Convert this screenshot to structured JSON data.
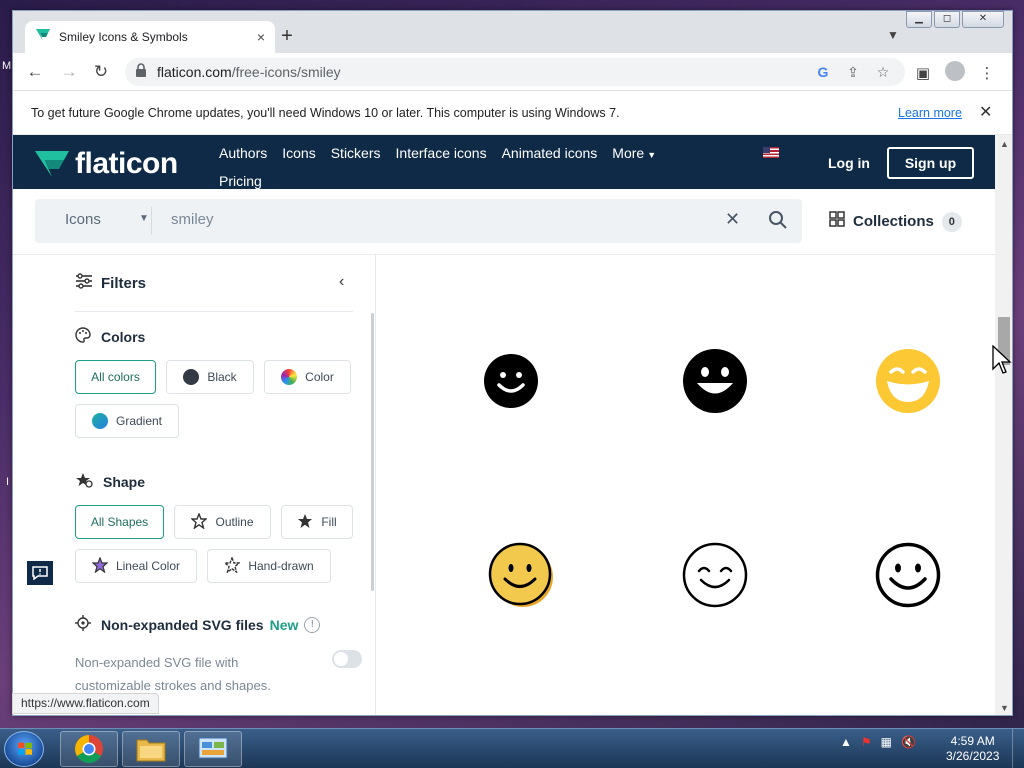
{
  "desktop": {
    "label_top": "M",
    "label_mid": "I"
  },
  "tab": {
    "title": "Smiley Icons & Symbols",
    "close": "×",
    "new_tab": "+"
  },
  "window_controls": {
    "minimize": "▭",
    "maximize": "◻",
    "close": "✕"
  },
  "address_bar": {
    "domain": "flaticon.com",
    "path": "/free-icons/smiley"
  },
  "infobar": {
    "message": "To get future Google Chrome updates, you'll need Windows 10 or later. This computer is using Windows 7.",
    "link": "Learn more",
    "close": "✕"
  },
  "flaticon": {
    "logo_text": "flaticon",
    "nav": [
      "Authors",
      "Icons",
      "Stickers",
      "Interface icons",
      "Animated icons",
      "More",
      "Pricing"
    ],
    "login": "Log in",
    "signup": "Sign up"
  },
  "search": {
    "type": "Icons",
    "query": "smiley",
    "collections_label": "Collections",
    "collections_count": "0"
  },
  "filters": {
    "title": "Filters",
    "colors_title": "Colors",
    "colors": [
      {
        "label": "All colors",
        "active": true
      },
      {
        "label": "Black",
        "swatch": "#333a45"
      },
      {
        "label": "Color",
        "swatch": "conic"
      },
      {
        "label": "Gradient",
        "swatch": "gradient"
      }
    ],
    "shape_title": "Shape",
    "shapes": [
      {
        "label": "All Shapes",
        "active": true
      },
      {
        "label": "Outline",
        "icon": "star-outline-icon"
      },
      {
        "label": "Fill",
        "icon": "star-fill-icon"
      },
      {
        "label": "Lineal Color",
        "icon": "star-lineal-icon"
      },
      {
        "label": "Hand-drawn",
        "icon": "star-handdrawn-icon"
      }
    ],
    "svg_title": "Non-expanded SVG files",
    "svg_new": "New",
    "svg_info": "!",
    "svg_desc": "Non-expanded SVG file with customizable strokes and shapes."
  },
  "results": [
    {
      "name": "smiley-black-simple"
    },
    {
      "name": "smiley-black-grin"
    },
    {
      "name": "smiley-yellow-laugh"
    },
    {
      "name": "smiley-yellow-outline"
    },
    {
      "name": "smiley-outline-closed-eyes"
    },
    {
      "name": "smiley-outline-bold"
    }
  ],
  "status_url": "https://www.flaticon.com",
  "clock": {
    "time": "4:59 AM",
    "date": "3/26/2023"
  },
  "colors": {
    "header_bg": "#0e2a47",
    "accent_green": "#1e9e86",
    "link_blue": "#1a73e8"
  }
}
